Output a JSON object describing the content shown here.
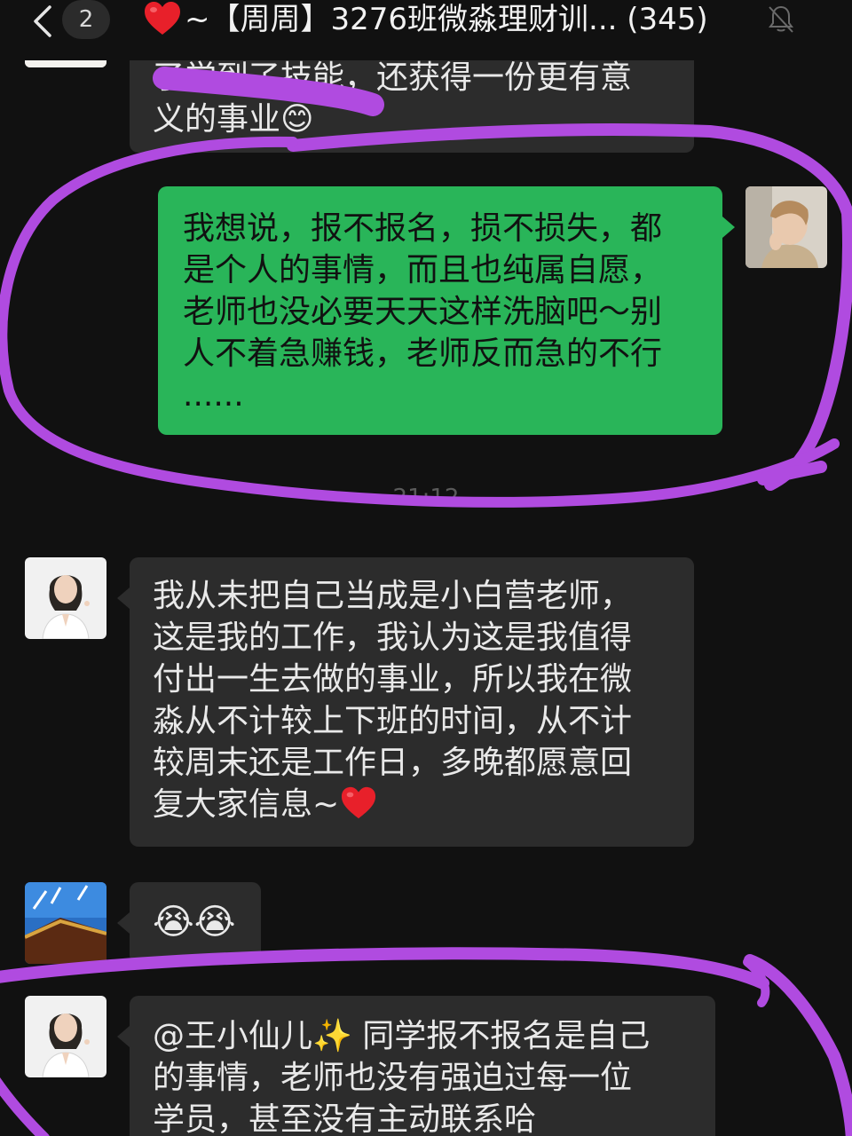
{
  "header": {
    "unread_count": "2",
    "title": "~【周周】3276班微淼理财训... (345)",
    "back_icon": "chevron-left-icon",
    "heart_icon": "red-heart-emoji",
    "mute_icon": "bell-slash-icon"
  },
  "messages": {
    "m0": {
      "lines": [
        "了学到了技能，还获得一份更有意",
        "义的事业😊"
      ]
    },
    "m1": {
      "lines": [
        "我想说，报不报名，损不损失，都",
        "是个人的事情，而且也纯属自愿，",
        "老师也没必要天天这样洗脑吧～别",
        "人不着急赚钱，老师反而急的不行",
        "......"
      ]
    },
    "timestamp": "21:12",
    "m2": {
      "lines": [
        "我从未把自己当成是小白营老师，",
        "这是我的工作，我认为这是我值得",
        "付出一生去做的事业，所以我在微",
        "淼从不计较上下班的时间，从不计",
        "较周末还是工作日，多晚都愿意回",
        "复大家信息~"
      ]
    },
    "m3": {
      "text": "😭😭"
    },
    "m4": {
      "lines": [
        "@王小仙儿✨ 同学报不报名是自己",
        "的事情，老师也没有强迫过每一位",
        "学员，甚至没有主动联系哈"
      ]
    }
  },
  "colors": {
    "background": "#111111",
    "bubble_in": "#2c2c2c",
    "bubble_out": "#29b559",
    "annotation": "#b04be0"
  }
}
